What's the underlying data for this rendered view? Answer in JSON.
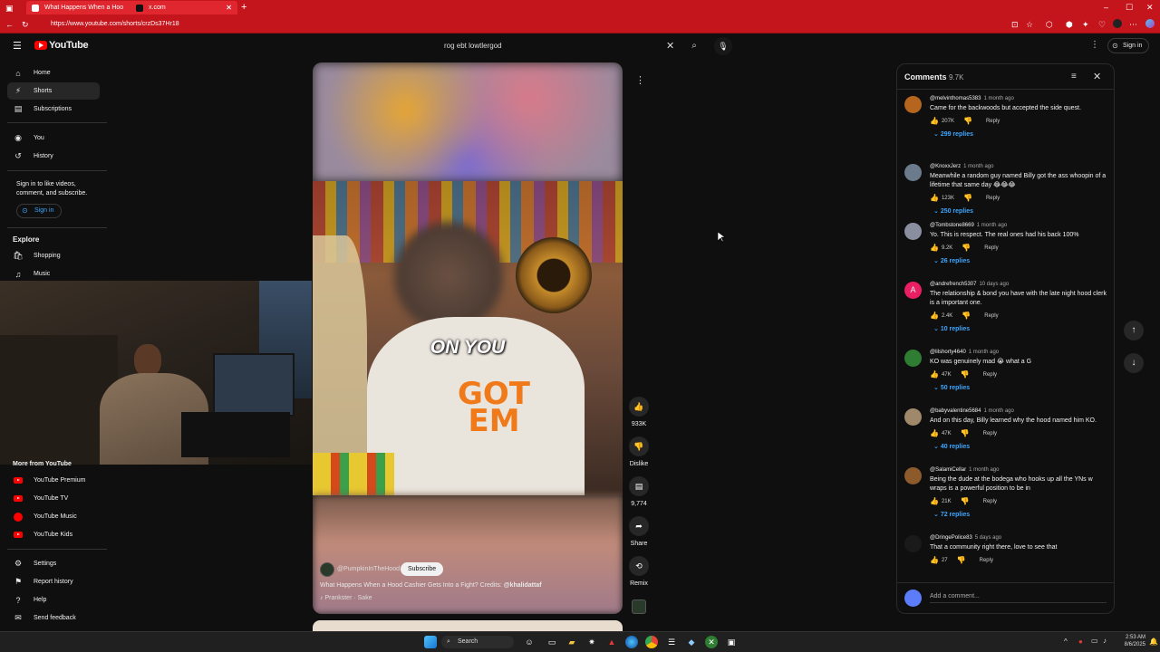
{
  "browser": {
    "tabs": [
      {
        "title": "What Happens When a Hoo",
        "active": true
      },
      {
        "title": "x.com",
        "active": false
      }
    ],
    "url": "https://www.youtube.com/shorts/crzDs37Hr18"
  },
  "header": {
    "logo_text": "YouTube",
    "search_value": "rog ebt lowtlergod",
    "signin_label": "Sign in"
  },
  "sidebar": {
    "top_items": [
      {
        "label": "Home",
        "icon": "home-icon"
      },
      {
        "label": "Shorts",
        "icon": "shorts-icon"
      },
      {
        "label": "Subscriptions",
        "icon": "subscriptions-icon"
      }
    ],
    "you_items": [
      {
        "label": "You",
        "icon": "you-icon"
      },
      {
        "label": "History",
        "icon": "history-icon"
      }
    ],
    "signin_prompt": "Sign in to like videos, comment, and subscribe.",
    "signin_button": "Sign in",
    "explore_title": "Explore",
    "explore_items": [
      {
        "label": "Shopping",
        "icon": "shopping-icon"
      },
      {
        "label": "Music",
        "icon": "music-icon"
      }
    ],
    "more_title": "More from YouTube",
    "more_items": [
      {
        "label": "YouTube Premium"
      },
      {
        "label": "YouTube TV"
      },
      {
        "label": "YouTube Music"
      },
      {
        "label": "YouTube Kids"
      }
    ],
    "bottom_items": [
      {
        "label": "Settings",
        "icon": "gear-icon"
      },
      {
        "label": "Report history",
        "icon": "flag-icon"
      },
      {
        "label": "Help",
        "icon": "help-icon"
      },
      {
        "label": "Send feedback",
        "icon": "feedback-icon"
      }
    ]
  },
  "video": {
    "caption_overlay": "ON YOU",
    "shirt_text": "GOT\nEM",
    "channel": "@PumpkinInTheHood",
    "subscribe_label": "Subscribe",
    "title": "What Happens When a Hood Cashier Gets Into a Fight? Credits:",
    "credit": "@khalidattaf",
    "sound": "Prankster · Sake"
  },
  "actions": {
    "like_count": "933K",
    "dislike_label": "Dislike",
    "comment_count": "9,774",
    "share_label": "Share",
    "remix_label": "Remix"
  },
  "comments": {
    "title": "Comments",
    "count": "9.7K",
    "add_placeholder": "Add a comment...",
    "reply_label": "Reply",
    "items": [
      {
        "author": "@melvinthomas5383",
        "time": "1 month ago",
        "text": "Came for the backwoods but accepted the side quest.",
        "likes": "207K",
        "replies": "299 replies",
        "avatar_color": "#b5651d"
      },
      {
        "author": "@KnoxxJerz",
        "time": "1 month ago",
        "text": "Meanwhile a random guy named Billy got the ass whoopin of a lifetime that same day 😂😂😂",
        "likes": "123K",
        "replies": "250 replies",
        "avatar_color": "#6b7b8c"
      },
      {
        "author": "@Tombstone8669",
        "time": "1 month ago",
        "text": "Yo. This is respect. The real ones had his back 100%",
        "likes": "9.2K",
        "replies": "26 replies",
        "avatar_color": "#8a8fa0"
      },
      {
        "author": "@andrefrench5307",
        "time": "10 days ago",
        "text": "The relationship & bond you have with the late night hood clerk is a important one.",
        "likes": "2.4K",
        "replies": "10 replies",
        "avatar_color": "#e91e63",
        "initial": "A"
      },
      {
        "author": "@lilshorty4640",
        "time": "1 month ago",
        "text": "KO was genuinely mad 😭 what a G",
        "likes": "47K",
        "replies": "50 replies",
        "avatar_color": "#2e7d32"
      },
      {
        "author": "@babyvalentine5684",
        "time": "1 month ago",
        "text": "And on this day, Billy learned why the hood named him KO.",
        "likes": "47K",
        "replies": "40 replies",
        "avatar_color": "#a0896a"
      },
      {
        "author": "@SalamiCellar",
        "time": "1 month ago",
        "text": "Being the dude at the bodega who hooks up all the YNs w wraps is a powerful position to be in",
        "likes": "21K",
        "replies": "72 replies",
        "avatar_color": "#8d5a2b"
      },
      {
        "author": "@DringePolice83",
        "time": "5 days ago",
        "text": "That a community right there, love to see that",
        "likes": "27",
        "replies": "",
        "avatar_color": "#1a1a1a"
      }
    ]
  },
  "taskbar": {
    "search_label": "Search",
    "time": "2:53 AM",
    "date": "8/6/2025"
  }
}
